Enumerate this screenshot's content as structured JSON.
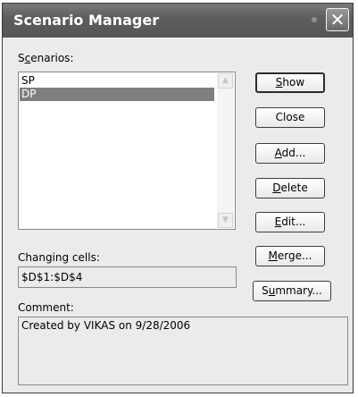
{
  "window": {
    "title": "Scenario Manager",
    "close_glyph": "✕"
  },
  "scenarios": {
    "label_prefix": "S",
    "label_mnemonic": "c",
    "label_rest": "enarios:",
    "items": [
      {
        "label": "SP",
        "selected": false
      },
      {
        "label": "DP",
        "selected": true
      }
    ],
    "scroll_up_glyph": "▲",
    "scroll_down_glyph": "▼"
  },
  "changing_cells": {
    "label": "Changing cells:",
    "value": "$D$1:$D$4"
  },
  "comment": {
    "label": "Comment:",
    "value": "Created by VIKAS on 9/28/2006"
  },
  "buttons": {
    "show": {
      "mnemonic": "S",
      "rest": "how"
    },
    "close": {
      "label": "Close"
    },
    "add": {
      "mnemonic": "A",
      "rest": "dd..."
    },
    "delete": {
      "mnemonic": "D",
      "rest": "elete"
    },
    "edit": {
      "mnemonic": "E",
      "rest": "dit..."
    },
    "merge": {
      "mnemonic": "M",
      "rest": "erge..."
    },
    "summary": {
      "prefix": "S",
      "mnemonic": "u",
      "rest": "mmary..."
    }
  },
  "colors": {
    "title_bar": "#5e5e5e",
    "selection": "#7f7f7f",
    "dialog_bg": "#ebebeb"
  }
}
